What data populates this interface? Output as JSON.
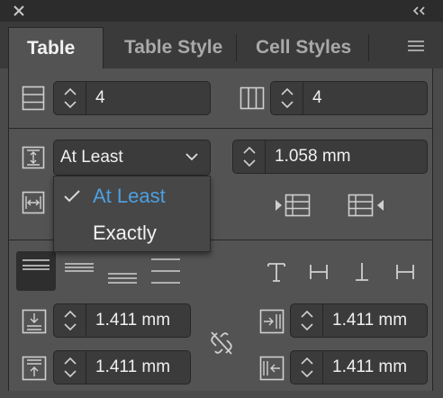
{
  "tabs": [
    {
      "label": "Table"
    },
    {
      "label": "Table Style"
    },
    {
      "label": "Cell Styles"
    }
  ],
  "rows": {
    "value": "4"
  },
  "columns": {
    "value": "4"
  },
  "row_height": {
    "mode": "At Least",
    "value": "1.058 mm"
  },
  "row_height_menu": {
    "options": [
      "At Least",
      "Exactly"
    ]
  },
  "cell_insets": {
    "top": "1.411 mm",
    "bottom": "1.411 mm",
    "left": "1.411 mm",
    "right": "1.411 mm"
  },
  "colors": {
    "panel": "#535353",
    "field": "#3b3b3b",
    "selected_option": "#4d9fe0"
  }
}
